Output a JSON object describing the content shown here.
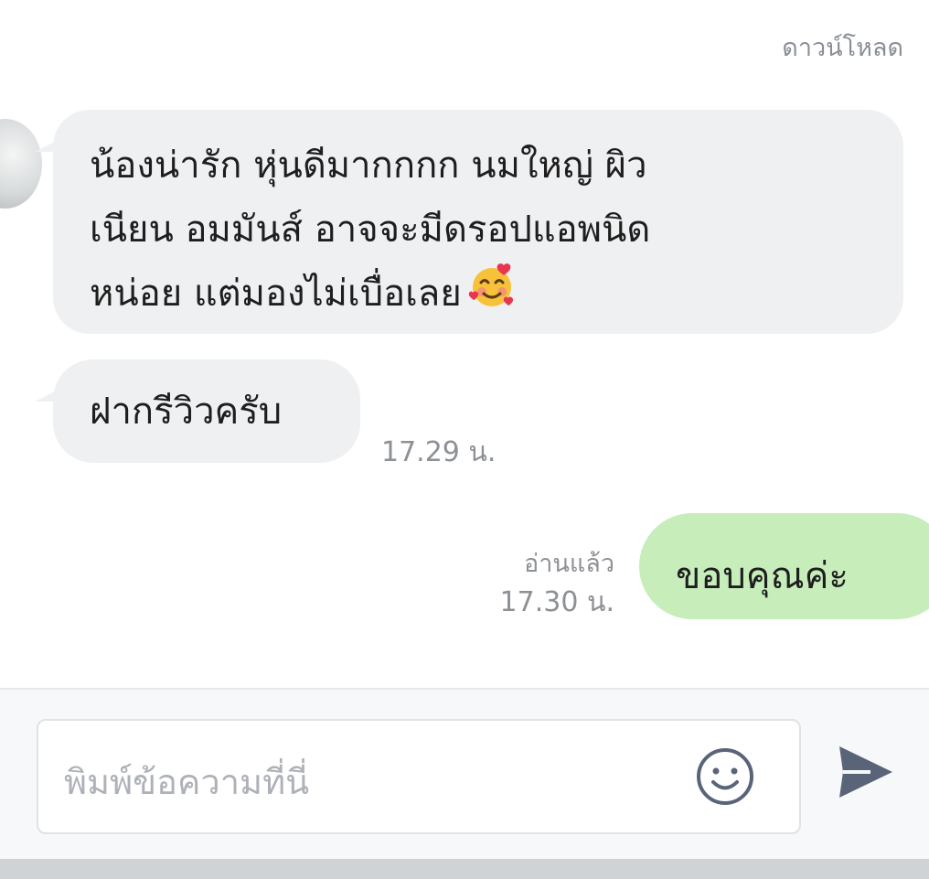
{
  "header": {
    "download_label": "ดาวน์โหลด"
  },
  "messages": {
    "incoming_1": {
      "line1": "น้องน่ารัก หุ่นดีมากกกก นมใหญ่ ผิว",
      "line2": "เนียน อมมันส์ อาจจะมีดรอปแอพนิด",
      "line3": "หน่อย แต่มองไม่เบื่อเลย",
      "emoji": "smiling-face-with-hearts-icon"
    },
    "incoming_2": {
      "text": "ฝากรีวิวครับ",
      "time": "17.29 น."
    },
    "outgoing_1": {
      "text": "ขอบคุณค่ะ",
      "read_status": "อ่านแล้ว",
      "time": "17.30 น."
    }
  },
  "composer": {
    "placeholder": "พิมพ์ข้อความที่นี่",
    "emoji_button_icon": "smile-icon",
    "send_button_icon": "send-icon"
  },
  "colors": {
    "incoming_bubble": "#eff0f2",
    "outgoing_bubble": "#c7edbb",
    "meta_text": "#8d9095",
    "icon": "#5a6478"
  }
}
